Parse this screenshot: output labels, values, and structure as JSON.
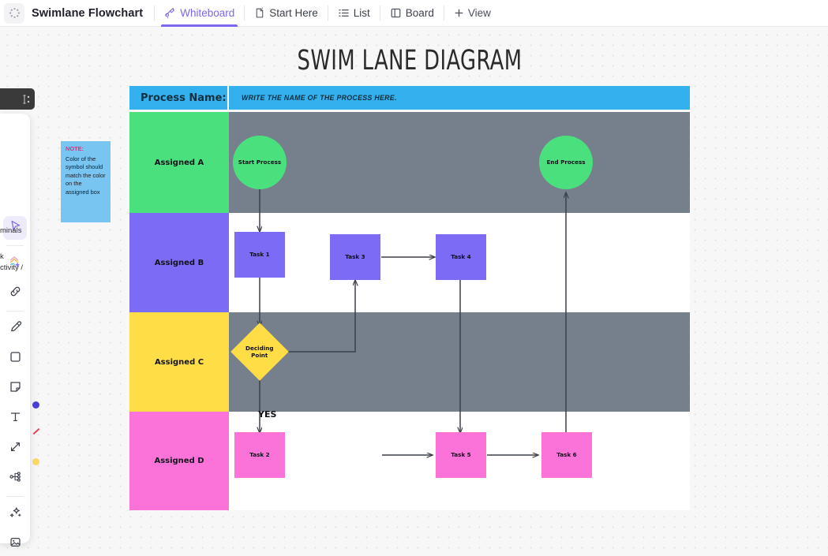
{
  "topbar": {
    "logo_icon": "dots-circle-icon",
    "doc_title": "Swimlane Flowchart",
    "tabs": [
      {
        "label": "Whiteboard",
        "icon": "whiteboard-icon",
        "active": true
      },
      {
        "label": "Start Here",
        "icon": "doc-icon",
        "active": false
      },
      {
        "label": "List",
        "icon": "list-icon",
        "active": false
      },
      {
        "label": "Board",
        "icon": "board-icon",
        "active": false
      }
    ],
    "add_view_label": "View",
    "add_view_icon": "plus-icon",
    "active_accent": "#7b68ee"
  },
  "toolbar": {
    "tools": [
      {
        "name": "select-tool",
        "icon": "cursor-icon",
        "selected": true
      },
      {
        "name": "shapes-tool",
        "icon": "shapes-add-icon",
        "selected": false
      },
      {
        "name": "link-tool",
        "icon": "link-icon",
        "selected": false
      },
      {
        "name": "pen-tool",
        "icon": "highlighter-icon",
        "selected": false
      },
      {
        "name": "rectangle-tool",
        "icon": "square-icon",
        "selected": false
      },
      {
        "name": "sticky-note-tool",
        "icon": "sticky-note-icon",
        "selected": false
      },
      {
        "name": "text-tool",
        "icon": "text-t-icon",
        "selected": false
      },
      {
        "name": "connector-tool",
        "icon": "connector-arrow-icon",
        "selected": false
      },
      {
        "name": "mindmap-tool",
        "icon": "mindmap-icon",
        "selected": false
      },
      {
        "name": "ai-tool",
        "icon": "sparkle-icon",
        "selected": false
      },
      {
        "name": "image-tool",
        "icon": "image-icon",
        "selected": false
      }
    ],
    "legend_fragments": [
      "minals",
      "k",
      "ctivity /"
    ],
    "swatches": [
      "#4a3fd4",
      "#e8415a",
      "#fbd24a"
    ]
  },
  "sticky_note": {
    "keyword": "NOTE:",
    "body": "Color of the symbol should match the color on the assigned box",
    "color": "#79c5f2"
  },
  "diagram": {
    "title": "SWIM LANE DIAGRAM",
    "process_label": "Process Name:",
    "process_value": "WRITE THE NAME OF THE PROCESS HERE.",
    "header_color": "#33b1ef",
    "lanes": [
      {
        "label": "Assigned A",
        "color": "#4be07e",
        "band": "#767f8c"
      },
      {
        "label": "Assigned B",
        "color": "#7b6bf5",
        "band": "#ffffff"
      },
      {
        "label": "Assigned C",
        "color": "#ffdd46",
        "band": "#767f8c"
      },
      {
        "label": "Assigned D",
        "color": "#fb72d9",
        "band": "#ffffff"
      }
    ],
    "nodes": [
      {
        "id": "start",
        "label": "Start Process",
        "shape": "circle",
        "color": "#4be07e"
      },
      {
        "id": "end",
        "label": "End Process",
        "shape": "circle",
        "color": "#4be07e"
      },
      {
        "id": "task1",
        "label": "Task 1",
        "shape": "rect",
        "color": "#7b6bf5"
      },
      {
        "id": "task3",
        "label": "Task 3",
        "shape": "rect",
        "color": "#7b6bf5"
      },
      {
        "id": "task4",
        "label": "Task 4",
        "shape": "rect",
        "color": "#7b6bf5"
      },
      {
        "id": "decision",
        "label": "Deciding Point",
        "shape": "diamond",
        "color": "#ffdd46"
      },
      {
        "id": "task2",
        "label": "Task 2",
        "shape": "rect",
        "color": "#fb72d9"
      },
      {
        "id": "task5",
        "label": "Task 5",
        "shape": "rect",
        "color": "#fb72d9"
      },
      {
        "id": "task6",
        "label": "Task 6",
        "shape": "rect",
        "color": "#fb72d9"
      }
    ],
    "edge_labels": [
      "YES"
    ]
  }
}
